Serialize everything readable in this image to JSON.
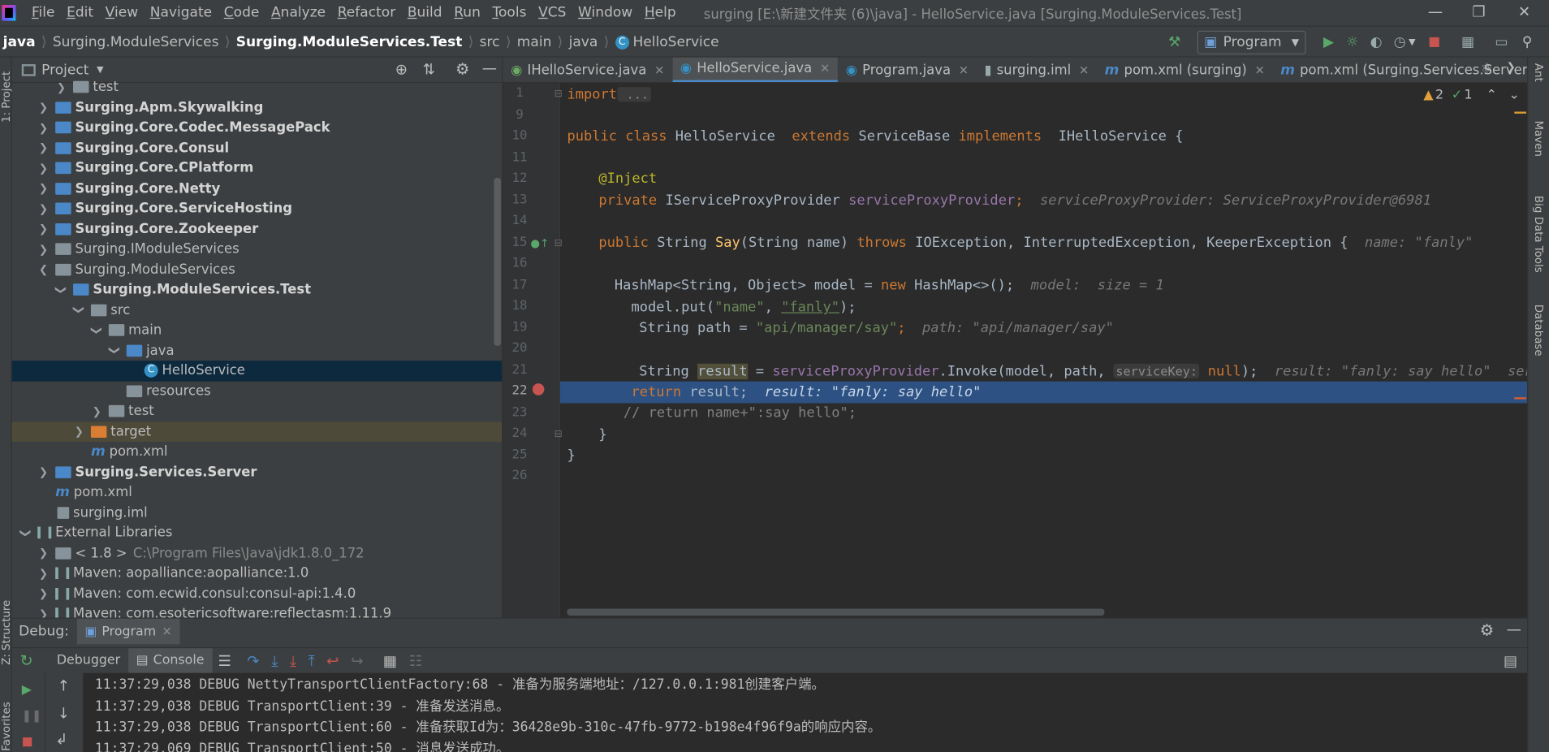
{
  "menubar": {
    "items": [
      "File",
      "Edit",
      "View",
      "Navigate",
      "Code",
      "Analyze",
      "Refactor",
      "Build",
      "Run",
      "Tools",
      "VCS",
      "Window",
      "Help"
    ],
    "window_title": "surging [E:\\新建文件夹 (6)\\java] - HelloService.java [Surging.ModuleServices.Test]"
  },
  "navbar": {
    "crumbs": [
      "java",
      "Surging.ModuleServices",
      "Surging.ModuleServices.Test",
      "src",
      "main",
      "java",
      "HelloService"
    ],
    "run_config": "Program"
  },
  "leftstrip": {
    "project": "1: Project",
    "structure": "Z: Structure",
    "favorites": "Favorites"
  },
  "project": {
    "title": "Project",
    "rows": [
      {
        "label": "test"
      },
      {
        "label": "Surging.Apm.Skywalking"
      },
      {
        "label": "Surging.Core.Codec.MessagePack"
      },
      {
        "label": "Surging.Core.Consul"
      },
      {
        "label": "Surging.Core.CPlatform"
      },
      {
        "label": "Surging.Core.Netty"
      },
      {
        "label": "Surging.Core.ServiceHosting"
      },
      {
        "label": "Surging.Core.Zookeeper"
      },
      {
        "label": "Surging.IModuleServices"
      },
      {
        "label": "Surging.ModuleServices"
      },
      {
        "label": "Surging.ModuleServices.Test"
      },
      {
        "label": "src"
      },
      {
        "label": "main"
      },
      {
        "label": "java"
      },
      {
        "label": "HelloService"
      },
      {
        "label": "resources"
      },
      {
        "label": "test"
      },
      {
        "label": "target"
      },
      {
        "label": "pom.xml"
      },
      {
        "label": "Surging.Services.Server"
      },
      {
        "label": "pom.xml"
      },
      {
        "label": "surging.iml"
      },
      {
        "label": "External Libraries"
      },
      {
        "label": "< 1.8 >",
        "extra": "C:\\Program Files\\Java\\jdk1.8.0_172"
      },
      {
        "label": "Maven: aopalliance:aopalliance:1.0"
      },
      {
        "label": "Maven: com.ecwid.consul:consul-api:1.4.0"
      },
      {
        "label": "Maven: com.esotericsoftware:reflectasm:1.11.9"
      }
    ]
  },
  "tabs": [
    "IHelloService.java",
    "HelloService.java",
    "Program.java",
    "surging.iml",
    "pom.xml (surging)",
    "pom.xml (Surging.Services.Server)"
  ],
  "editor": {
    "line_numbers": [
      "1",
      "9",
      "10",
      "11",
      "12",
      "13",
      "14",
      "15",
      "16",
      "17",
      "18",
      "19",
      "20",
      "21",
      "22",
      "23",
      "24",
      "25",
      "26"
    ],
    "warnings": "2",
    "checks": "1",
    "lines": {
      "l1_kw": "import",
      "l1_rest": " ...",
      "l10_a": "public class ",
      "l10_b": "HelloService  ",
      "l10_c": "extends ",
      "l10_d": "ServiceBase ",
      "l10_e": "implements ",
      "l10_f": " IHelloService {",
      "l12": "@Inject",
      "l13_a": "private ",
      "l13_b": "IServiceProxyProvider ",
      "l13_c": "serviceProxyProvider",
      "l13_d": ";",
      "l13_hint": "  serviceProxyProvider: ServiceProxyProvider@6981",
      "l15_a": "public ",
      "l15_b": "String ",
      "l15_c": "Say",
      "l15_d": "(String name) ",
      "l15_e": "throws ",
      "l15_f": "IOException, InterruptedException, KeeperException {",
      "l15_hint": "  name: \"fanly\"",
      "l17_a": "HashMap<String, Object> model = ",
      "l17_b": "new ",
      "l17_c": "HashMap<>();",
      "l17_hint": "  model:  size = 1",
      "l18_a": "model.put(",
      "l18_b": "\"name\"",
      ", ": ", ",
      "l18_c": "\"fanly\"",
      "l18_d": ");",
      "l19_a": "String path = ",
      "l19_b": "\"api/manager/say\"",
      "l19_c": ";",
      "l19_hint": "  path: \"api/manager/say\"",
      "l21_a": "String ",
      "l21_b": "result",
      " l21_c": " = ",
      "l21_d": "serviceProxyProvider",
      ".Invoke": ".Invoke(model, path, ",
      "l21_inlay": "serviceKey:",
      "l21_e": " null",
      "l21_f": ");",
      "l21_hint": "  result: \"fanly: say hello\"  servic",
      "l22_a": "return ",
      "l22_b": "result;",
      "l22_hint": "  result: \"fanly: say hello\"",
      "l23": "// return name+\":say hello\";",
      "l24": "}",
      "l25": "}"
    }
  },
  "debug": {
    "label": "Debug:",
    "session": "Program",
    "tabs": [
      "Debugger",
      "Console"
    ],
    "logs": [
      "11:37:29,038 DEBUG NettyTransportClientFactory:68 - 准备为服务端地址：/127.0.0.1:981创建客户端。",
      "11:37:29,038 DEBUG TransportClient:39 - 准备发送消息。",
      "11:37:29,038 DEBUG TransportClient:60 - 准备获取Id为：36428e9b-310c-47fb-9772-b198e4f96f9a的响应内容。",
      "11:37:29,069 DEBUG TransportClient:50 - 消息发送成功。"
    ]
  },
  "rightstrip": [
    "Ant",
    "Maven",
    "Big Data Tools",
    "Database"
  ],
  "colors": {
    "accent": "#4a88c7",
    "selection": "#2d5183",
    "keyword": "#cc7832",
    "string": "#6a8759",
    "field": "#9876aa"
  }
}
